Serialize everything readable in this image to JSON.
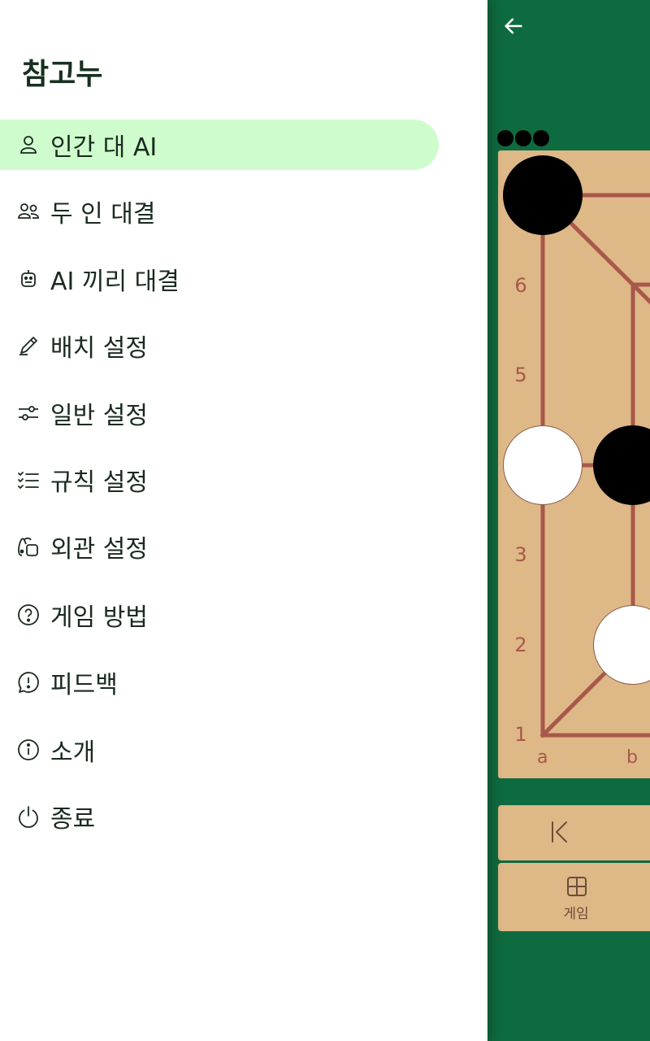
{
  "drawer": {
    "title": "참고누",
    "items": [
      {
        "label": "인간 대 AI",
        "icon": "person-icon",
        "active": true
      },
      {
        "label": "두 인 대결",
        "icon": "people-icon"
      },
      {
        "label": "AI 끼리 대결",
        "icon": "robot-icon"
      },
      {
        "label": "배치 설정",
        "icon": "pencil-icon"
      },
      {
        "label": "일반 설정",
        "icon": "sliders-icon"
      },
      {
        "label": "규칙 설정",
        "icon": "checklist-icon"
      },
      {
        "label": "외관 설정",
        "icon": "palette-icon"
      },
      {
        "label": "게임 방법",
        "icon": "help-icon"
      },
      {
        "label": "피드백",
        "icon": "feedback-icon"
      },
      {
        "label": "소개",
        "icon": "info-icon"
      },
      {
        "label": "종료",
        "icon": "power-icon"
      }
    ]
  },
  "app": {
    "back_icon": "arrow-left-icon",
    "board": {
      "ranks": [
        "6",
        "5",
        "3",
        "2",
        "1"
      ],
      "files": [
        "a",
        "b"
      ],
      "colors": {
        "board": "#deb887",
        "line": "#a8584a"
      }
    },
    "controls": {
      "first_icon": "first-move-icon",
      "game_icon": "grid-icon",
      "game_label": "게임"
    }
  },
  "colors": {
    "accent": "#0e6a3f",
    "active_item": "#cffccc"
  }
}
